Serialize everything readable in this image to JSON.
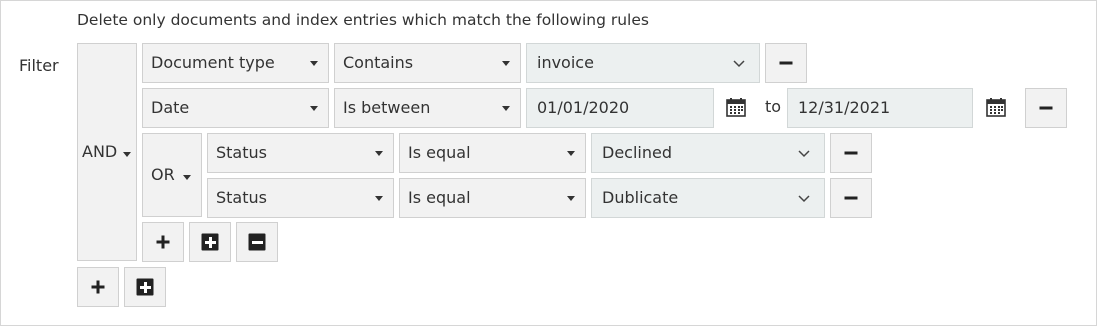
{
  "header": {
    "description": "Delete only documents and index entries which match the following rules"
  },
  "filter": {
    "label": "Filter",
    "and_label": "AND",
    "or_label": "OR",
    "rules": [
      {
        "field": "Document type",
        "operator": "Contains",
        "value": "invoice"
      },
      {
        "field": "Date",
        "operator": "Is between",
        "value_from": "01/01/2020",
        "to_label": "to",
        "value_to": "12/31/2021"
      }
    ],
    "or_rules": [
      {
        "field": "Status",
        "operator": "Is equal",
        "value": "Declined"
      },
      {
        "field": "Status",
        "operator": "Is equal",
        "value": "Dublicate"
      }
    ]
  },
  "colors": {
    "control_bg": "#f2f2f2",
    "input_bg": "#ecf0f0",
    "border": "#d0d0d0",
    "text": "#333333"
  }
}
